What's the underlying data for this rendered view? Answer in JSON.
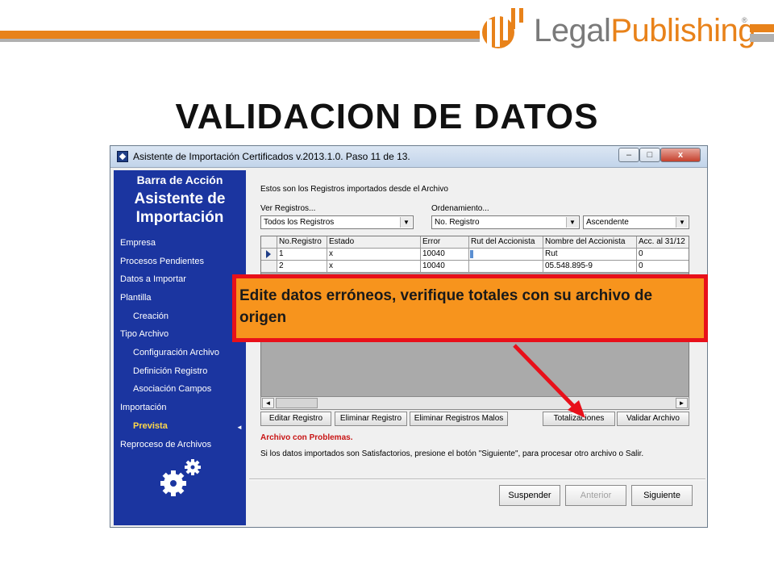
{
  "logo": {
    "legal": "Legal",
    "publishing": "Publishing",
    "reg": "®"
  },
  "slide_title": "VALIDACION DE DATOS",
  "window": {
    "title": "Asistente de Importación  Certificados v.2013.1.0. Paso 11 de 13.",
    "controls": {
      "minimize": "–",
      "maximize": "□",
      "close": "x"
    }
  },
  "sidebar": {
    "subtitle": "Barra de Acción",
    "title_line1": "Asistente de",
    "title_line2": "Importación",
    "items": [
      {
        "label": "Empresa"
      },
      {
        "label": "Procesos Pendientes"
      },
      {
        "label": "Datos a Importar"
      },
      {
        "label": "Plantilla"
      },
      {
        "label": "Creación"
      },
      {
        "label": "Tipo Archivo"
      },
      {
        "label": "Configuración Archivo"
      },
      {
        "label": "Definición Registro"
      },
      {
        "label": "Asociación Campos"
      },
      {
        "label": "Importación"
      },
      {
        "label": "Prevista"
      },
      {
        "label": "Reproceso de Archivos"
      }
    ],
    "active_arrow": "◄"
  },
  "main": {
    "header": "Estos son los Registros importados desde el Archivo",
    "ver_label": "Ver Registros...",
    "ver_value": "Todos los Registros",
    "orden_label": "Ordenamiento...",
    "orden_value": "No. Registro",
    "orden_dir": "Ascendente",
    "grid": {
      "columns": [
        "No.Registro",
        "Estado",
        "Error",
        "Rut del Accionista",
        "Nombre del Accionista",
        "Acc. al 31/12"
      ],
      "rows": [
        [
          "1",
          "x",
          "10040",
          "",
          "Rut",
          "0"
        ],
        [
          "2",
          "x",
          "10040",
          "",
          "05.548.895-9",
          "0"
        ]
      ]
    },
    "buttons": {
      "editar": "Editar Registro",
      "eliminar": "Eliminar Registro",
      "eliminar_malos": "Eliminar Registros Malos",
      "totalizaciones": "Totalizaciones",
      "validar": "Validar Archivo"
    },
    "status_title": "Archivo con Problemas.",
    "status_message": "Si los datos importados son Satisfactorios, presione el botón \"Siguiente\", para procesar otro archivo o Salir.",
    "nav": {
      "suspender": "Suspender",
      "anterior": "Anterior",
      "siguiente": "Siguiente"
    }
  },
  "callout": {
    "text": "Edite datos erróneos, verifique totales con su archivo de origen"
  },
  "colors": {
    "accent": "#e8821a",
    "sidebar": "#1b35a0",
    "callout_border": "#e8101a",
    "callout_fill": "#f7941d",
    "error_text": "#c81414"
  }
}
